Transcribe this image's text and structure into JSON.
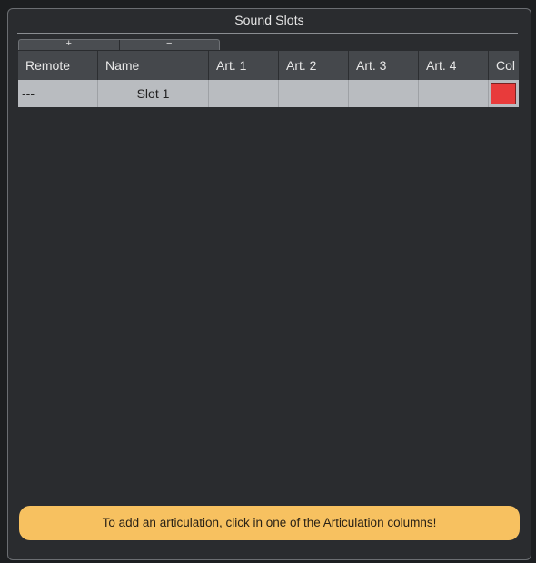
{
  "panel": {
    "title": "Sound Slots"
  },
  "toolbar": {
    "add_label": "+",
    "remove_label": "−"
  },
  "table": {
    "columns": [
      "Remote",
      "Name",
      "Art. 1",
      "Art. 2",
      "Art. 3",
      "Art. 4",
      "Col"
    ],
    "rows": [
      {
        "remote": "---",
        "name": "Slot 1",
        "art1": "",
        "art2": "",
        "art3": "",
        "art4": "",
        "color": "#e83b3b"
      }
    ]
  },
  "hint": {
    "text": "To add an articulation, click in one of the Articulation columns!"
  }
}
